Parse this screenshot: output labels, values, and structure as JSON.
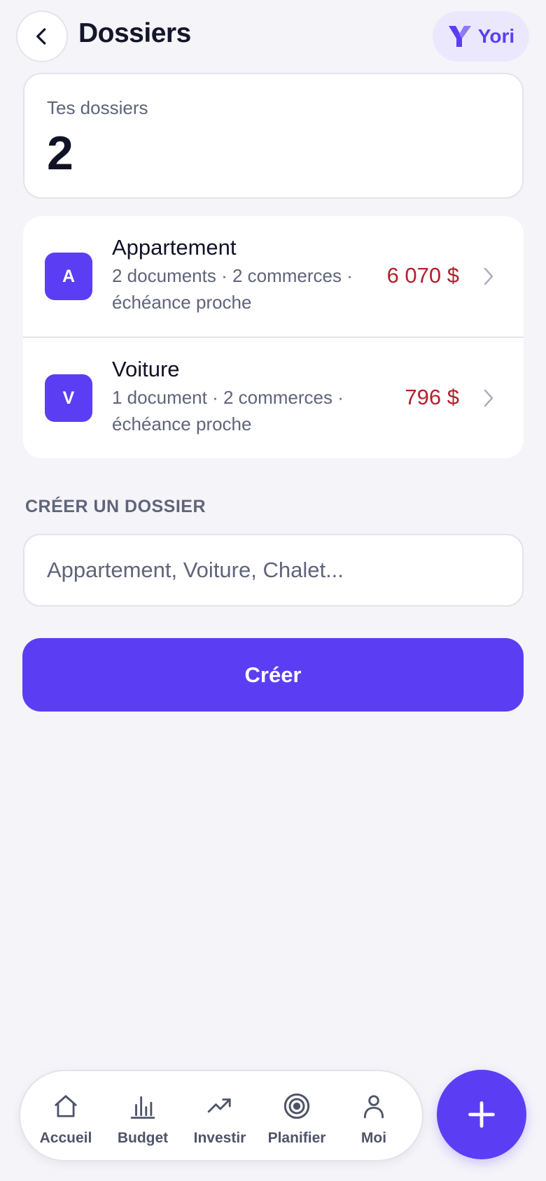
{
  "header": {
    "title": "Dossiers",
    "brand_name": "Yori"
  },
  "summary": {
    "label": "Tes dossiers",
    "count": "2"
  },
  "folders": [
    {
      "initial": "A",
      "name": "Appartement",
      "meta": "2 documents · 2 commerces · échéance proche",
      "amount": "6 070 $"
    },
    {
      "initial": "V",
      "name": "Voiture",
      "meta": "1 document · 2 commerces · échéance proche",
      "amount": "796 $"
    }
  ],
  "create": {
    "section_label": "CRÉER UN DOSSIER",
    "placeholder": "Appartement, Voiture, Chalet...",
    "button_label": "Créer"
  },
  "nav": {
    "items": [
      {
        "label": "Accueil",
        "icon": "home-icon"
      },
      {
        "label": "Budget",
        "icon": "bar-chart-icon"
      },
      {
        "label": "Investir",
        "icon": "trending-up-icon"
      },
      {
        "label": "Planifier",
        "icon": "target-icon"
      },
      {
        "label": "Moi",
        "icon": "user-icon"
      }
    ]
  },
  "fab": {
    "icon": "plus-icon"
  },
  "colors": {
    "accent": "#5b3ef4",
    "background": "#f4f4f9",
    "amount_red": "#b3212d",
    "muted_text": "#5f6479"
  }
}
